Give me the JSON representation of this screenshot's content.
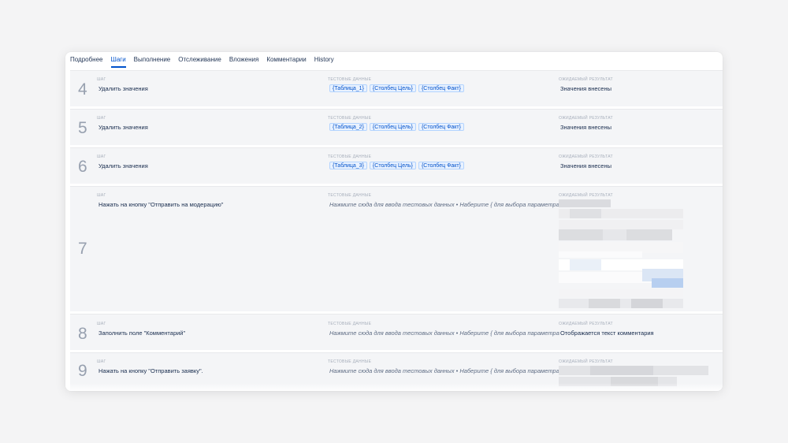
{
  "tabs": [
    {
      "label": "Подробнее",
      "active": false
    },
    {
      "label": "Шаги",
      "active": true
    },
    {
      "label": "Выполнение",
      "active": false
    },
    {
      "label": "Отслеживание",
      "active": false
    },
    {
      "label": "Вложения",
      "active": false
    },
    {
      "label": "Комментарии",
      "active": false
    },
    {
      "label": "History",
      "active": false
    }
  ],
  "columns": {
    "step": "ШАГ",
    "test_data": "ТЕСТОВЫЕ ДАННЫЕ",
    "expected": "ОЖИДАЕМЫЙ РЕЗУЛЬТАТ"
  },
  "steps": [
    {
      "number": "4",
      "action": "Удалить значения",
      "tags": [
        "{Таблица_1}",
        "{Столбец Цель}",
        "{Столбец Факт}"
      ],
      "expected": "Значения внесены"
    },
    {
      "number": "5",
      "action": "Удалить значения",
      "tags": [
        "{Таблица_2}",
        "{Столбец Цель}",
        "{Столбец Факт}"
      ],
      "expected": "Значения внесены"
    },
    {
      "number": "6",
      "action": "Удалить значения",
      "tags": [
        "{Таблица_3}",
        "{Столбец Цель}",
        "{Столбец Факт}"
      ],
      "expected": "Значения внесены"
    },
    {
      "number": "7",
      "action": "Нажать на кнопку \"Отправить на модерацию\"",
      "placeholder": "Нажмите сюда для ввода тестовых данных • Наберите { для выбора параметра",
      "expected": ""
    },
    {
      "number": "8",
      "action": "Заполнить поле \"Комментарий\"",
      "placeholder": "Нажмите сюда для ввода тестовых данных • Наберите { для выбора параметра",
      "expected": "Отображается текст комментария"
    },
    {
      "number": "9",
      "action": "Нажать на кнопку \"Отправить заявку\".",
      "placeholder": "Нажмите сюда для ввода тестовых данных • Наберите { для выбора параметра",
      "expected": ""
    }
  ]
}
